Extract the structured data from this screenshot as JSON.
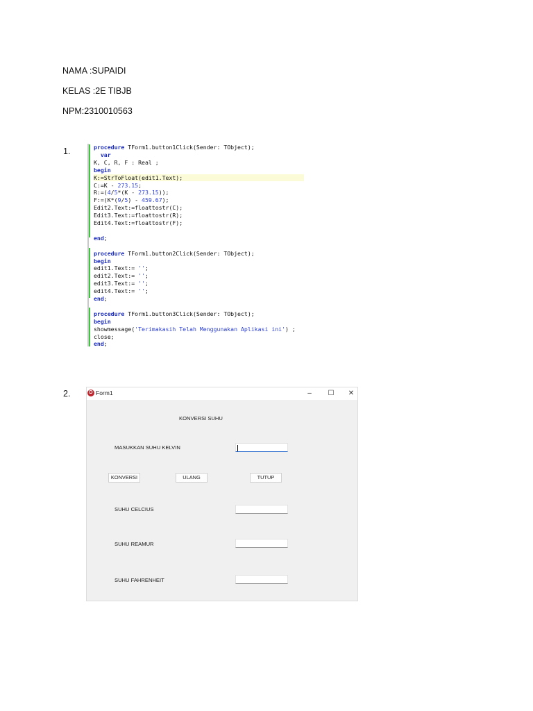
{
  "header": {
    "nama": "NAMA :SUPAIDI",
    "kelas": "KELAS :2E TIBJB",
    "npm": "NPM:2310010563"
  },
  "item_numbers": [
    "1.",
    "2."
  ],
  "code_lines": [
    {
      "segments": [
        [
          "procedure",
          "kw"
        ],
        [
          " TForm1.button1Click(Sender: TObject);",
          ""
        ]
      ]
    },
    {
      "segments": [
        [
          "  var",
          "kw"
        ]
      ]
    },
    {
      "segments": [
        [
          "K, C, R, F : Real ;",
          ""
        ]
      ]
    },
    {
      "segments": [
        [
          "begin",
          "kw"
        ]
      ]
    },
    {
      "segments": [
        [
          "K:=StrToFloat(edit1.Text);",
          ""
        ]
      ],
      "highlight": true
    },
    {
      "segments": [
        [
          "C:=K - ",
          ""
        ],
        [
          "273.15",
          "num"
        ],
        [
          ";",
          ""
        ]
      ]
    },
    {
      "segments": [
        [
          "R:=(",
          ""
        ],
        [
          "4",
          "num"
        ],
        [
          "/",
          ""
        ],
        [
          "5",
          "num"
        ],
        [
          "*(K - ",
          ""
        ],
        [
          "273.15",
          "num"
        ],
        [
          "));",
          ""
        ]
      ]
    },
    {
      "segments": [
        [
          "F:=(K*(",
          ""
        ],
        [
          "9",
          "num"
        ],
        [
          "/",
          ""
        ],
        [
          "5",
          "num"
        ],
        [
          ") - ",
          ""
        ],
        [
          "459.67",
          "num"
        ],
        [
          ");",
          ""
        ]
      ]
    },
    {
      "segments": [
        [
          "Edit2.Text:=floattostr(C);",
          ""
        ]
      ]
    },
    {
      "segments": [
        [
          "Edit3.Text:=floattostr(R);",
          ""
        ]
      ]
    },
    {
      "segments": [
        [
          "Edit4.Text:=floattostr(F);",
          ""
        ]
      ]
    },
    {
      "segments": [
        [
          "",
          ""
        ]
      ]
    },
    {
      "segments": [
        [
          "end",
          "kw"
        ],
        [
          ";",
          ""
        ]
      ]
    },
    {
      "segments": [
        [
          "",
          ""
        ]
      ]
    },
    {
      "segments": [
        [
          "procedure",
          "kw"
        ],
        [
          " TForm1.button2Click(Sender: TObject);",
          ""
        ]
      ]
    },
    {
      "segments": [
        [
          "begin",
          "kw"
        ]
      ]
    },
    {
      "segments": [
        [
          "edit1.Text:= ",
          ""
        ],
        [
          "''",
          "str"
        ],
        [
          ";",
          ""
        ]
      ]
    },
    {
      "segments": [
        [
          "edit2.Text:= ",
          ""
        ],
        [
          "''",
          "str"
        ],
        [
          ";",
          ""
        ]
      ]
    },
    {
      "segments": [
        [
          "edit3.Text:= ",
          ""
        ],
        [
          "''",
          "str"
        ],
        [
          ";",
          ""
        ]
      ]
    },
    {
      "segments": [
        [
          "edit4.Text:= ",
          ""
        ],
        [
          "''",
          "str"
        ],
        [
          ";",
          ""
        ]
      ]
    },
    {
      "segments": [
        [
          "end",
          "kw"
        ],
        [
          ";",
          ""
        ]
      ]
    },
    {
      "segments": [
        [
          "",
          ""
        ]
      ]
    },
    {
      "segments": [
        [
          "procedure",
          "kw"
        ],
        [
          " TForm1.button3Click(Sender: TObject);",
          ""
        ]
      ]
    },
    {
      "segments": [
        [
          "begin",
          "kw"
        ]
      ]
    },
    {
      "segments": [
        [
          "showmessage(",
          ""
        ],
        [
          "'Terimakasih Telah Menggunakan Aplikasi ini'",
          "str"
        ],
        [
          ") ;",
          ""
        ]
      ]
    },
    {
      "segments": [
        [
          "close;",
          ""
        ]
      ]
    },
    {
      "segments": [
        [
          "end",
          "kw"
        ],
        [
          ";",
          ""
        ]
      ]
    }
  ],
  "form": {
    "title": "Form1",
    "icon_letter": "D",
    "minimize": "–",
    "maximize": "☐",
    "close": "✕",
    "heading": "KONVERSI SUHU",
    "input_label": "MASUKKAN SUHU KELVIN",
    "buttons": {
      "konversi": "KONVERSI",
      "ulang": "ULANG",
      "tutup": "TUTUP"
    },
    "labels": {
      "celcius": "SUHU CELCIUS",
      "reamur": "SUHU REAMUR",
      "fahrenheit": "SUHU FAHRENHEIT"
    }
  }
}
